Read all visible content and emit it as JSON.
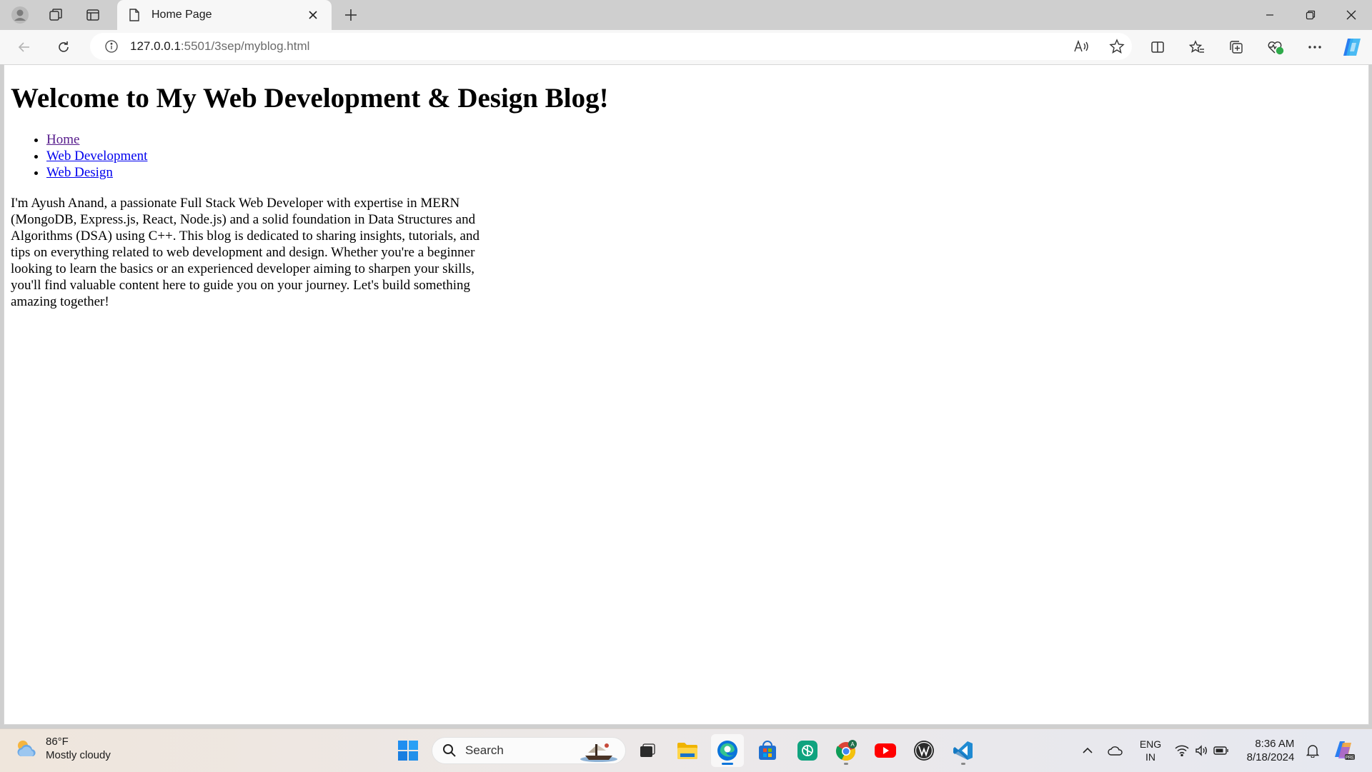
{
  "browser": {
    "tab": {
      "title": "Home Page"
    },
    "address": {
      "host": "127.0.0.1",
      "path": ":5501/3sep/myblog.html"
    }
  },
  "page": {
    "heading": "Welcome to My Web Development & Design Blog!",
    "nav": [
      {
        "label": "Home"
      },
      {
        "label": "Web Development"
      },
      {
        "label": "Web Design"
      }
    ],
    "intro": "I'm Ayush Anand, a passionate Full Stack Web Developer with expertise in MERN (MongoDB, Express.js, React, Node.js) and a solid foundation in Data Structures and Algorithms (DSA) using C++. This blog is dedicated to sharing insights, tutorials, and tips on everything related to web development and design. Whether you're a beginner looking to learn the basics or an experienced developer aiming to sharpen your skills, you'll find valuable content here to guide you on your journey. Let's build something amazing together!"
  },
  "taskbar": {
    "weather": {
      "temp": "86°F",
      "condition": "Mostly cloudy"
    },
    "search_label": "Search",
    "lang": {
      "line1": "ENG",
      "line2": "IN"
    },
    "clock": {
      "time": "8:36 AM",
      "date": "8/18/2024"
    }
  },
  "colors": {
    "link": "#0000ee",
    "visited_link": "#551a8b",
    "edge_blue": "#0a74da",
    "vscode_blue": "#1f8ad2",
    "youtube_red": "#ff0000"
  }
}
